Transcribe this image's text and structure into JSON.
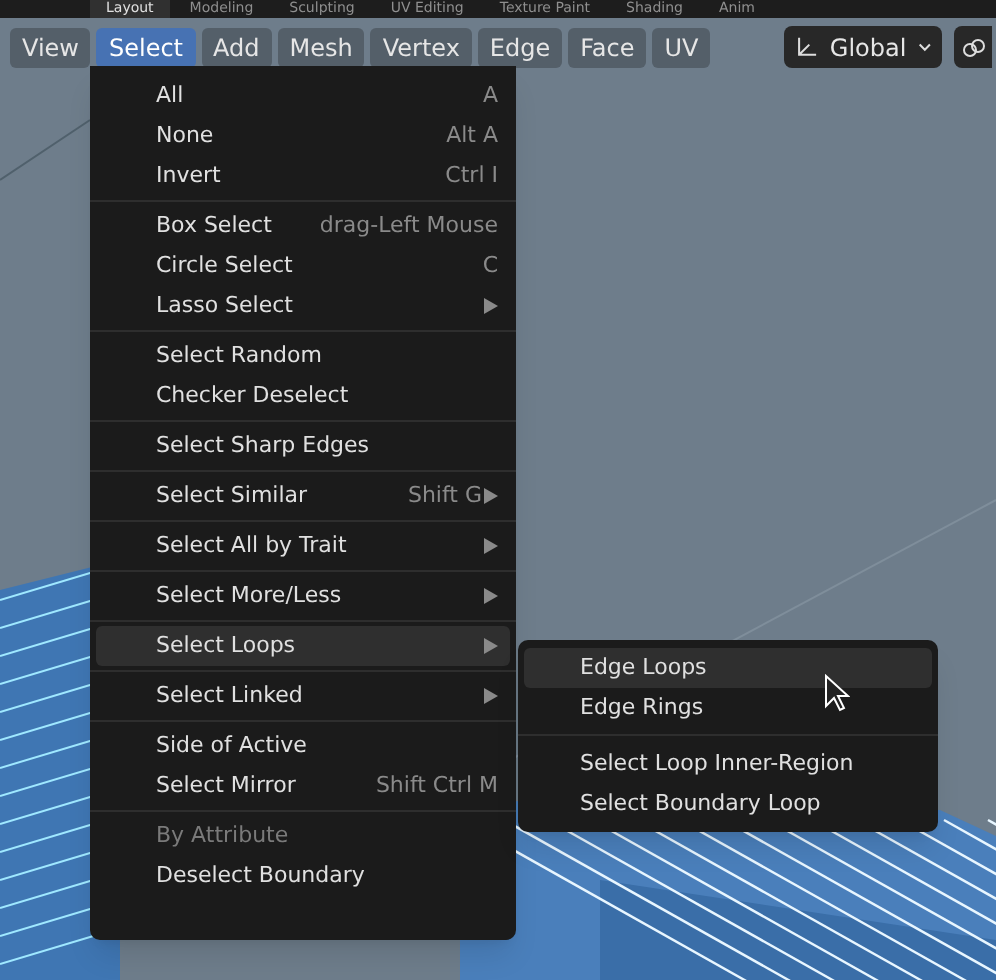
{
  "workspace_tabs": [
    {
      "label": "Layout",
      "selected": true
    },
    {
      "label": "Modeling",
      "selected": false
    },
    {
      "label": "Sculpting",
      "selected": false
    },
    {
      "label": "UV Editing",
      "selected": false
    },
    {
      "label": "Texture Paint",
      "selected": false
    },
    {
      "label": "Shading",
      "selected": false
    },
    {
      "label": "Anim",
      "selected": false
    }
  ],
  "header_menus": [
    {
      "label": "View",
      "selected": false
    },
    {
      "label": "Select",
      "selected": true
    },
    {
      "label": "Add",
      "selected": false
    },
    {
      "label": "Mesh",
      "selected": false
    },
    {
      "label": "Vertex",
      "selected": false
    },
    {
      "label": "Edge",
      "selected": false
    },
    {
      "label": "Face",
      "selected": false
    },
    {
      "label": "UV",
      "selected": false
    }
  ],
  "orientation": {
    "label": "Global"
  },
  "select_menu": {
    "sections": [
      [
        {
          "label": "All",
          "shortcut": "A",
          "submenu": false,
          "selected": false,
          "disabled": false
        },
        {
          "label": "None",
          "shortcut": "Alt A",
          "submenu": false,
          "selected": false,
          "disabled": false
        },
        {
          "label": "Invert",
          "shortcut": "Ctrl I",
          "submenu": false,
          "selected": false,
          "disabled": false
        }
      ],
      [
        {
          "label": "Box Select",
          "shortcut": "drag-Left Mouse",
          "submenu": false,
          "selected": false,
          "disabled": false
        },
        {
          "label": "Circle Select",
          "shortcut": "C",
          "submenu": false,
          "selected": false,
          "disabled": false
        },
        {
          "label": "Lasso Select",
          "submenu": true,
          "selected": false,
          "disabled": false
        }
      ],
      [
        {
          "label": "Select Random",
          "submenu": false,
          "selected": false,
          "disabled": false
        },
        {
          "label": "Checker Deselect",
          "submenu": false,
          "selected": false,
          "disabled": false
        }
      ],
      [
        {
          "label": "Select Sharp Edges",
          "submenu": false,
          "selected": false,
          "disabled": false
        }
      ],
      [
        {
          "label": "Select Similar",
          "shortcut": "Shift G",
          "submenu": true,
          "selected": false,
          "disabled": false
        }
      ],
      [
        {
          "label": "Select All by Trait",
          "submenu": true,
          "selected": false,
          "disabled": false
        }
      ],
      [
        {
          "label": "Select More/Less",
          "submenu": true,
          "selected": false,
          "disabled": false
        }
      ],
      [
        {
          "label": "Select Loops",
          "submenu": true,
          "selected": true,
          "disabled": false
        }
      ],
      [
        {
          "label": "Select Linked",
          "submenu": true,
          "selected": false,
          "disabled": false
        }
      ],
      [
        {
          "label": "Side of Active",
          "submenu": false,
          "selected": false,
          "disabled": false
        },
        {
          "label": "Select Mirror",
          "shortcut": "Shift Ctrl M",
          "submenu": false,
          "selected": false,
          "disabled": false
        }
      ],
      [
        {
          "label": "By Attribute",
          "submenu": false,
          "selected": false,
          "disabled": true
        },
        {
          "label": "Deselect Boundary",
          "submenu": false,
          "selected": false,
          "disabled": false
        }
      ]
    ]
  },
  "loops_submenu": {
    "sections": [
      [
        {
          "label": "Edge Loops",
          "selected": true
        },
        {
          "label": "Edge Rings",
          "selected": false
        }
      ],
      [
        {
          "label": "Select Loop Inner-Region",
          "selected": false
        },
        {
          "label": "Select Boundary Loop",
          "selected": false
        }
      ]
    ]
  }
}
